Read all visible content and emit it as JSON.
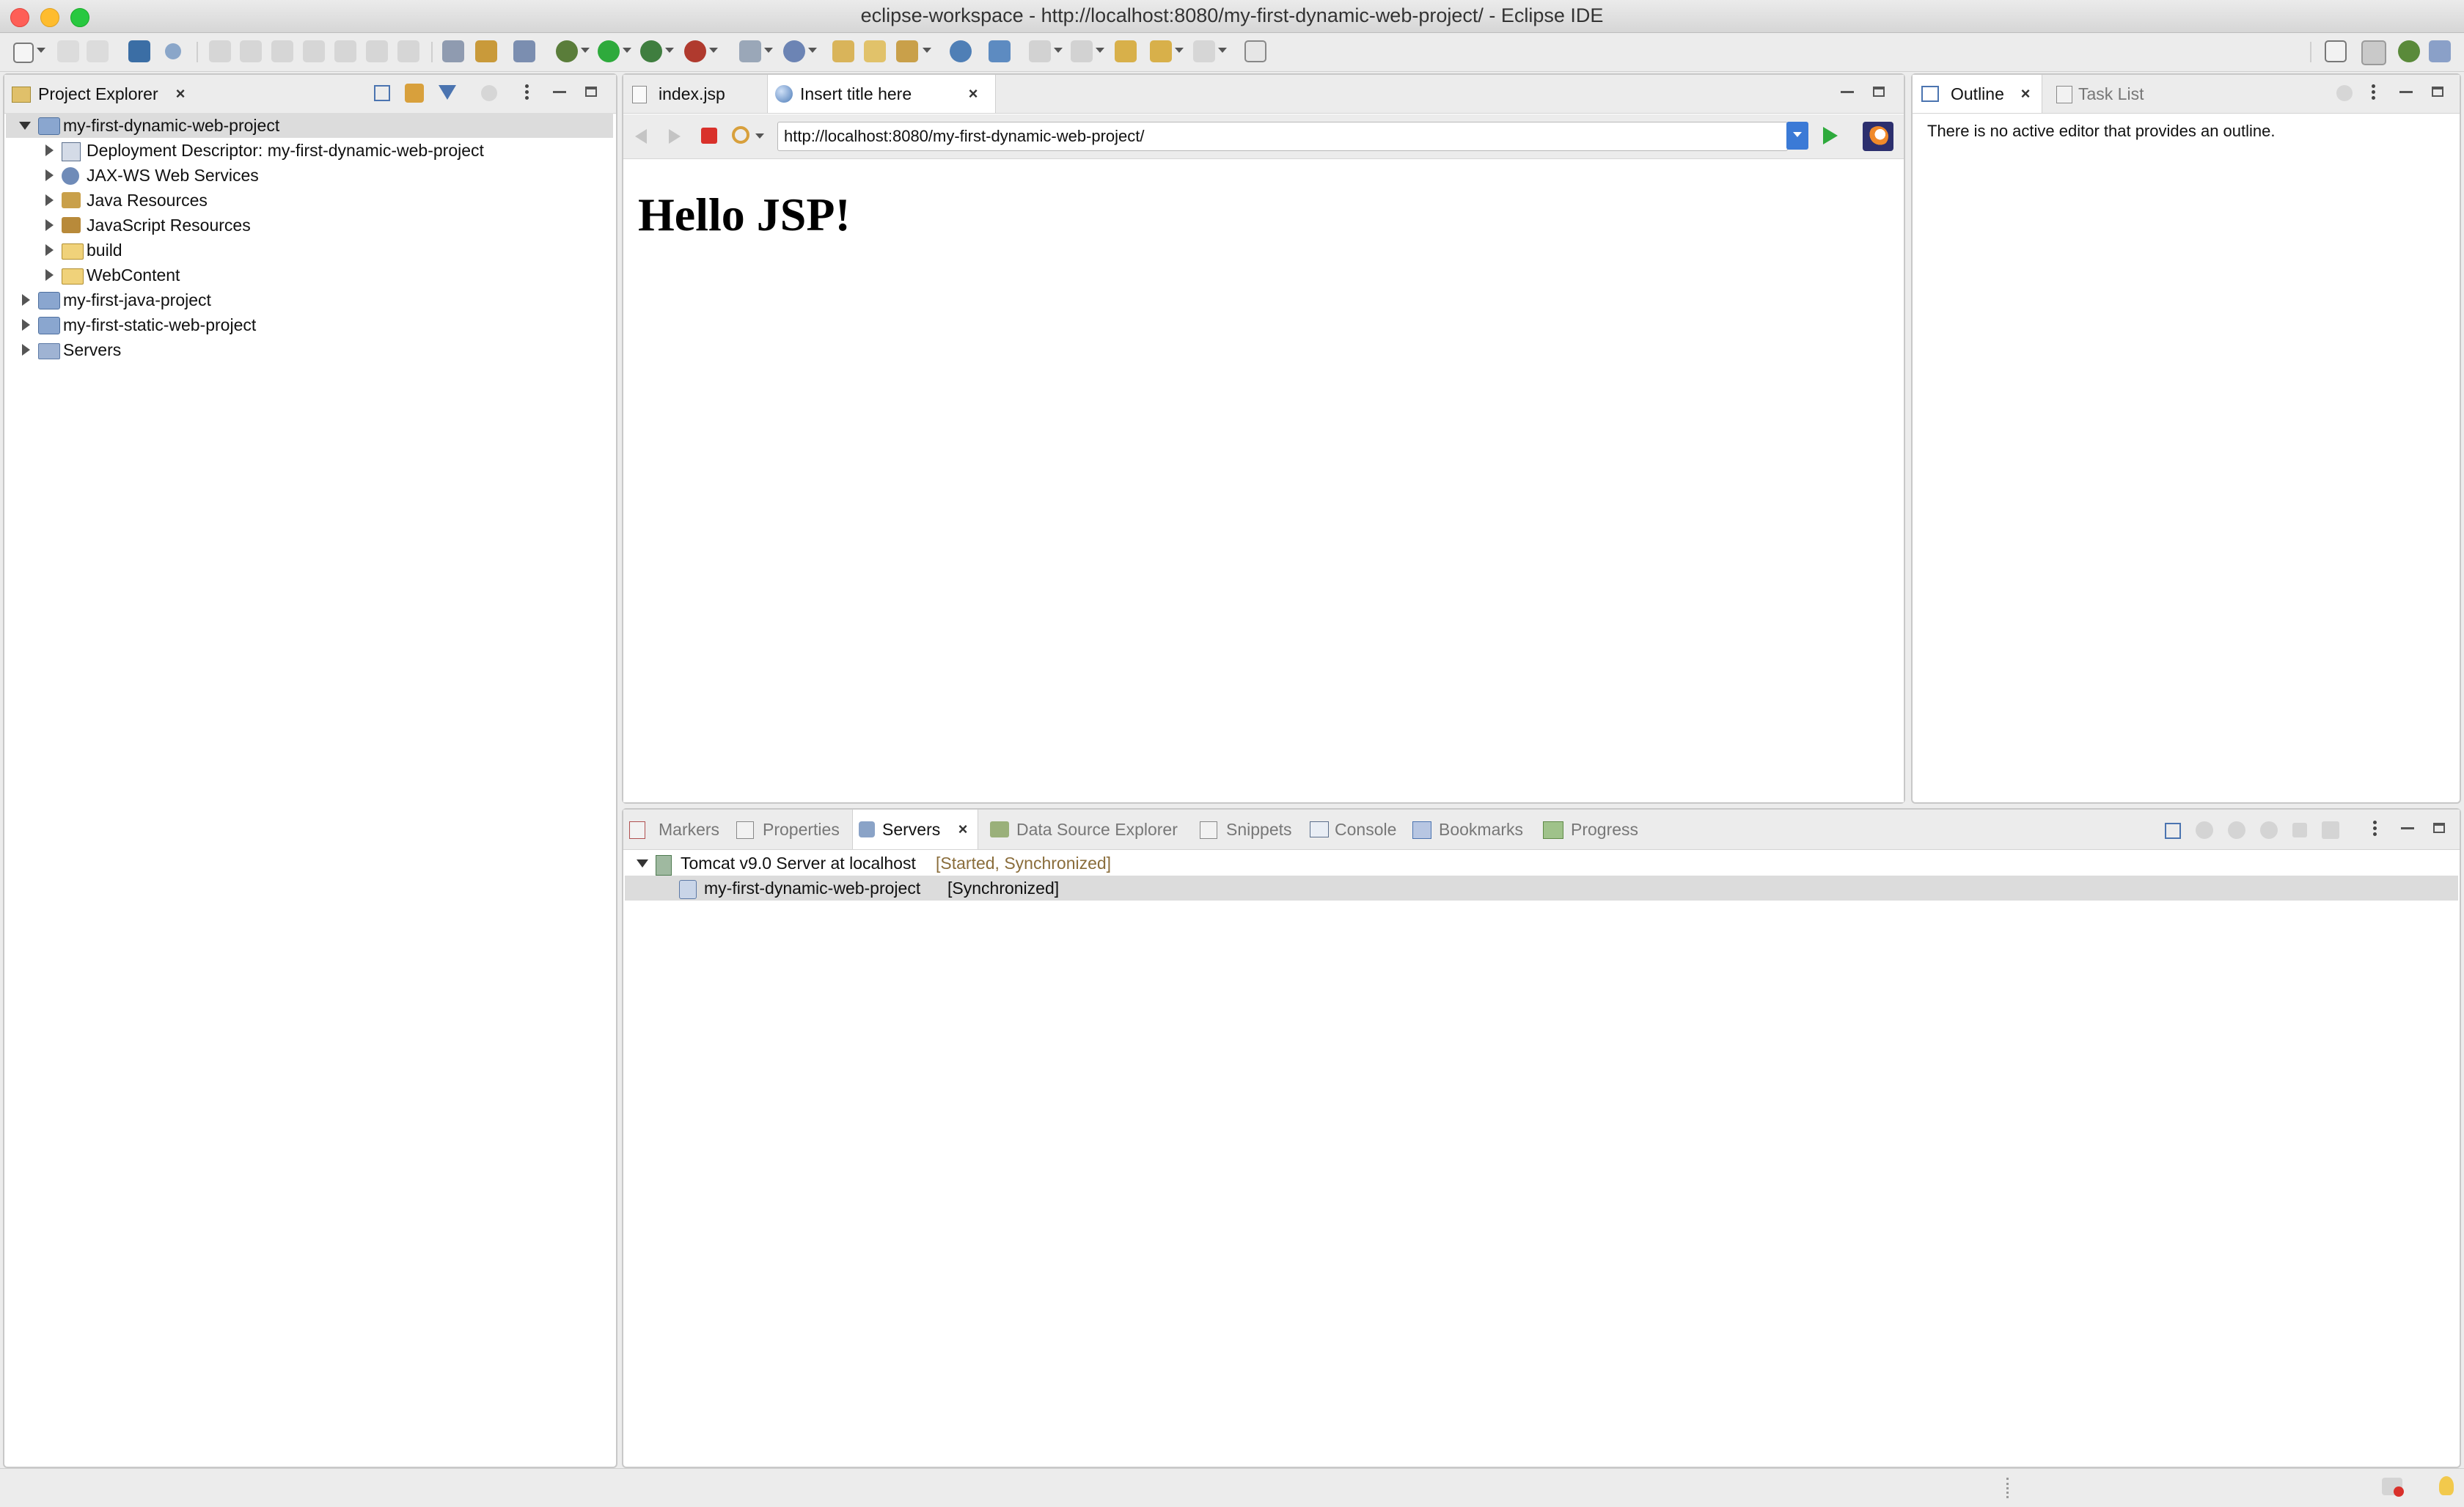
{
  "window": {
    "title": "eclipse-workspace - http://localhost:8080/my-first-dynamic-web-project/ - Eclipse IDE",
    "traffic_colors": {
      "close": "#fe5f57",
      "minimize": "#febc2e",
      "zoom": "#28c840"
    }
  },
  "project_explorer": {
    "tab_label": "Project Explorer",
    "tree": [
      {
        "label": "my-first-dynamic-web-project",
        "expanded": true,
        "selected": true
      },
      {
        "label": "Deployment Descriptor: my-first-dynamic-web-project"
      },
      {
        "label": "JAX-WS Web Services"
      },
      {
        "label": "Java Resources"
      },
      {
        "label": "JavaScript Resources"
      },
      {
        "label": "build"
      },
      {
        "label": "WebContent"
      },
      {
        "label": "my-first-java-project"
      },
      {
        "label": "my-first-static-web-project"
      },
      {
        "label": "Servers"
      }
    ]
  },
  "editor": {
    "tabs": [
      {
        "label": "index.jsp",
        "active": false
      },
      {
        "label": "Insert title here",
        "active": true
      }
    ],
    "browser": {
      "url": "http://localhost:8080/my-first-dynamic-web-project/",
      "page_heading": "Hello JSP!"
    }
  },
  "outline": {
    "tabs": [
      {
        "label": "Outline",
        "active": true
      },
      {
        "label": "Task List",
        "active": false
      }
    ],
    "message": "There is no active editor that provides an outline."
  },
  "bottom_panel": {
    "tabs": [
      {
        "label": "Markers",
        "active": false
      },
      {
        "label": "Properties",
        "active": false
      },
      {
        "label": "Servers",
        "active": true
      },
      {
        "label": "Data Source Explorer",
        "active": false
      },
      {
        "label": "Snippets",
        "active": false
      },
      {
        "label": "Console",
        "active": false
      },
      {
        "label": "Bookmarks",
        "active": false
      },
      {
        "label": "Progress",
        "active": false
      }
    ],
    "servers": [
      {
        "label": "Tomcat v9.0 Server at localhost",
        "status": "[Started, Synchronized]"
      },
      {
        "label": "my-first-dynamic-web-project",
        "status": "[Synchronized]"
      }
    ]
  },
  "colors": {
    "accent_blue": "#2f6fd6",
    "run_green": "#2eaa3c",
    "stop_red": "#d9312b",
    "status_brown": "#8a6d3b"
  }
}
